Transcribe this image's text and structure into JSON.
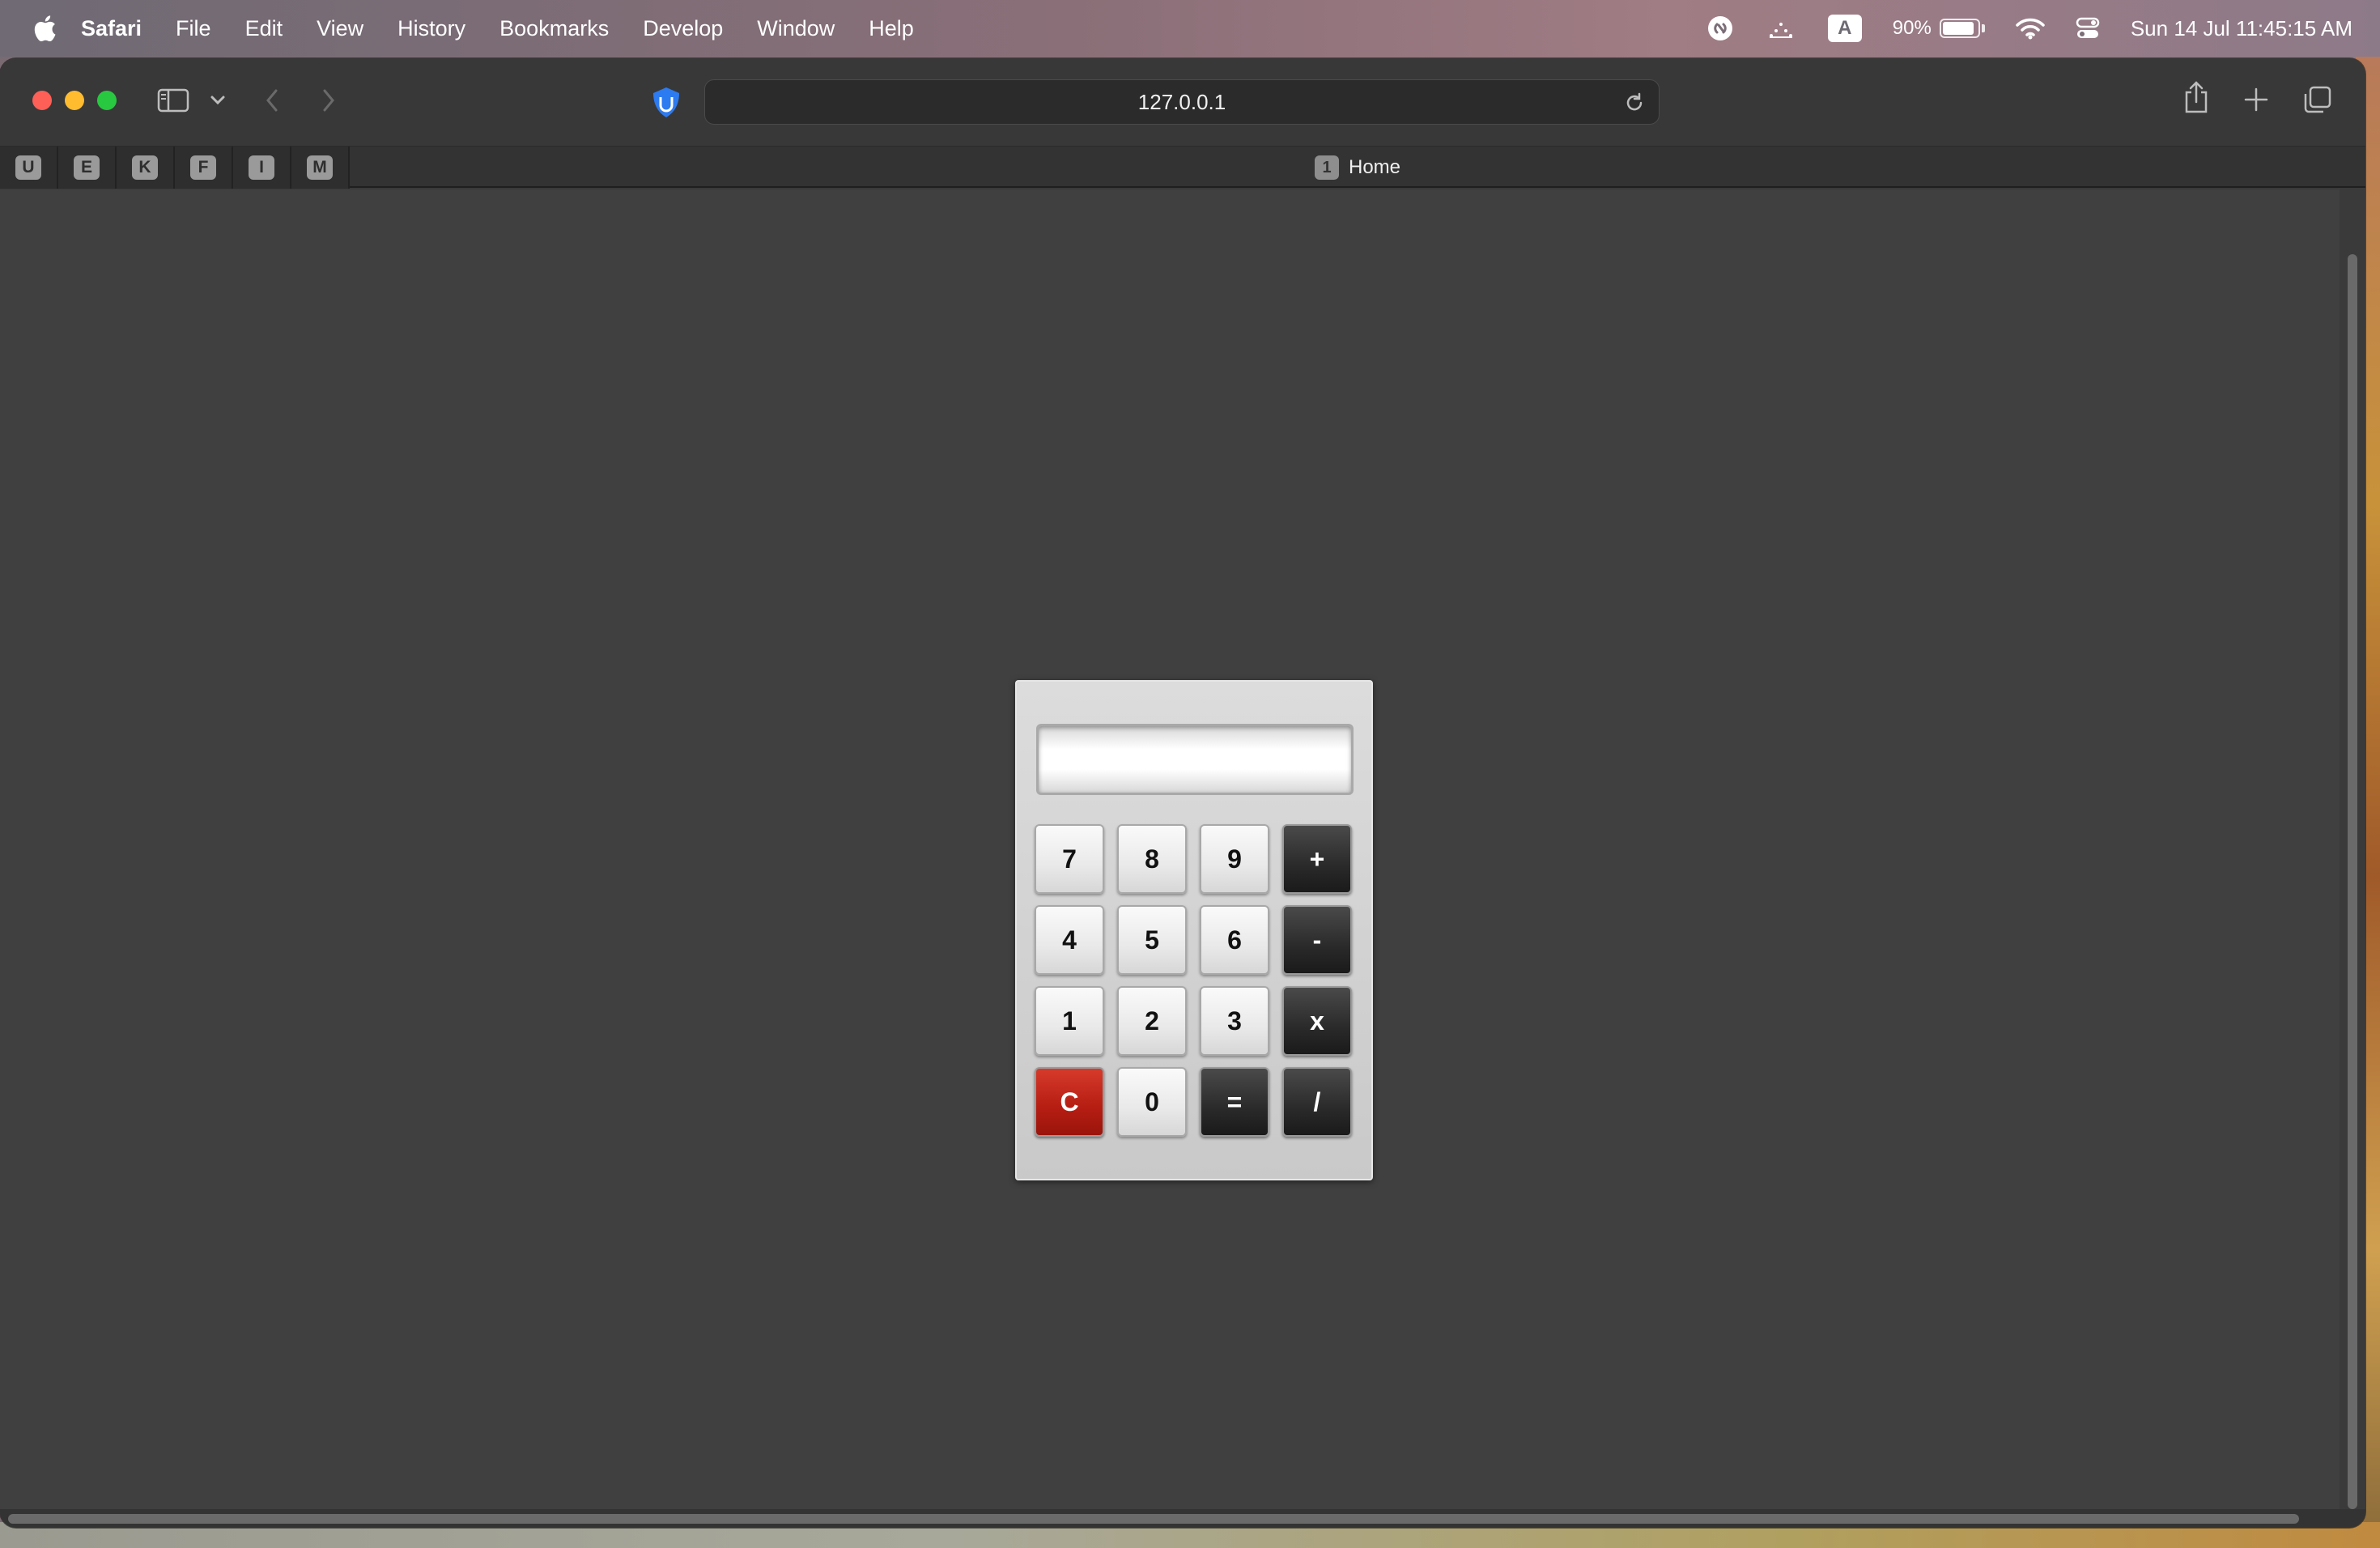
{
  "menubar": {
    "app_name": "Safari",
    "items": [
      "File",
      "Edit",
      "View",
      "History",
      "Bookmarks",
      "Develop",
      "Window",
      "Help"
    ],
    "input_source": "A",
    "battery_percent": "90%",
    "battery_level": 0.9,
    "datetime": "Sun 14 Jul  11:45:15 AM"
  },
  "browser": {
    "url": "127.0.0.1",
    "favorites": [
      "U",
      "E",
      "K",
      "F",
      "I",
      "M"
    ],
    "active_tab": {
      "index": "1",
      "title": "Home"
    }
  },
  "calculator": {
    "display_value": "",
    "keys": {
      "k7": "7",
      "k8": "8",
      "k9": "9",
      "add": "+",
      "k4": "4",
      "k5": "5",
      "k6": "6",
      "subtract": "-",
      "k1": "1",
      "k2": "2",
      "k3": "3",
      "multiply": "x",
      "clear": "C",
      "k0": "0",
      "equals": "=",
      "divide": "/"
    }
  },
  "colors": {
    "page_background": "#404040",
    "clear_key": "#b51d12",
    "operator_key": "#2a2a2a",
    "number_key": "#e9e9e9"
  }
}
